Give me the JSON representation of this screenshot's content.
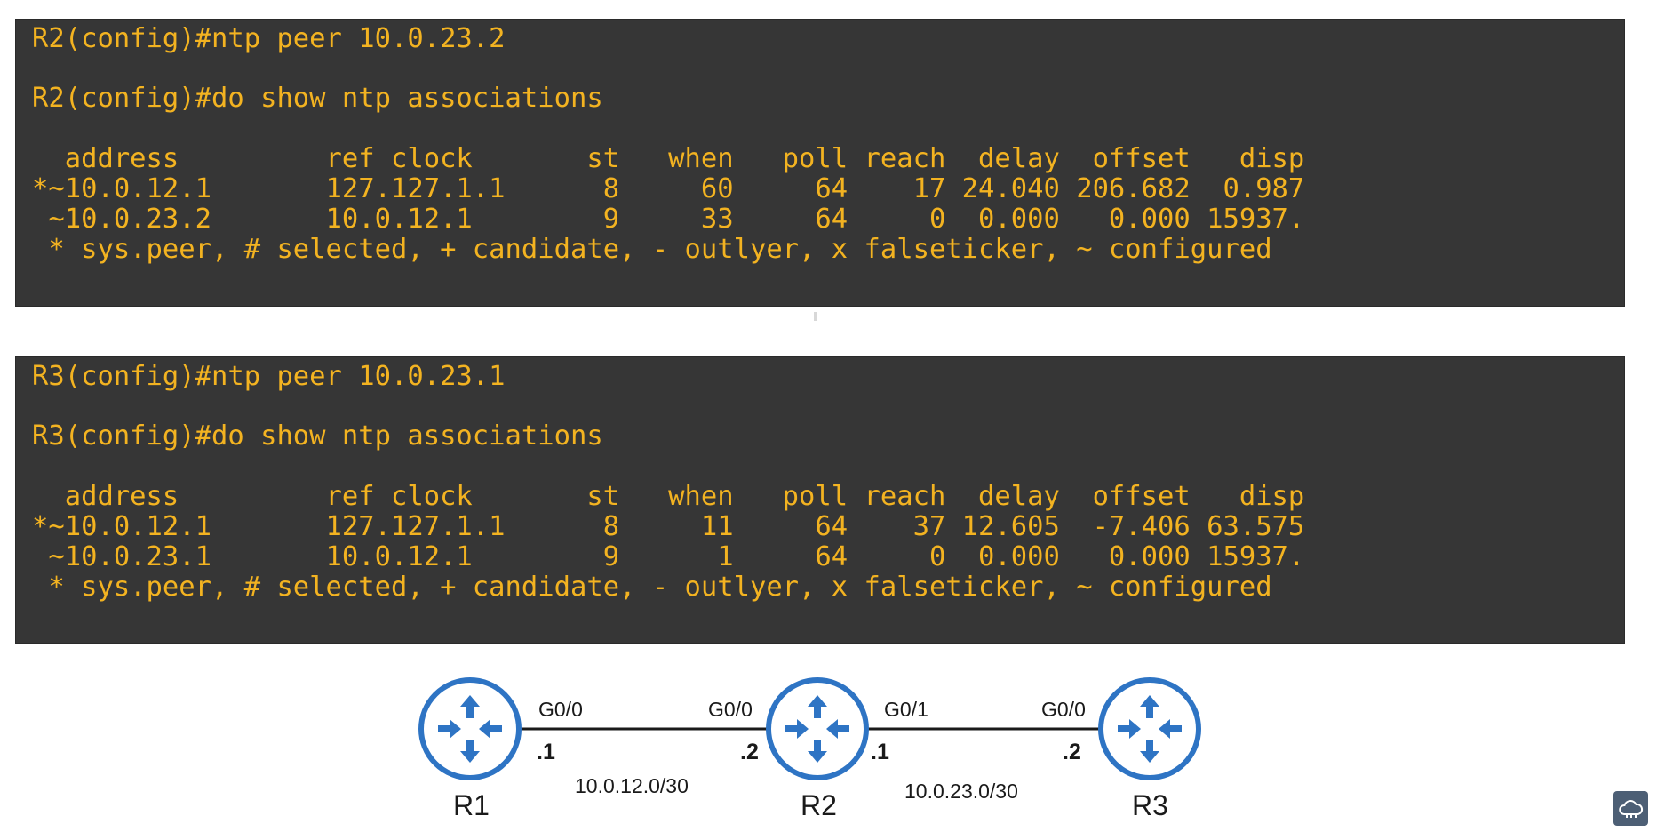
{
  "terminals": [
    {
      "lines": [
        "R2(config)#ntp peer 10.0.23.2",
        "",
        "R2(config)#do show ntp associations",
        "",
        "  address         ref clock       st   when   poll reach  delay  offset   disp",
        "*~10.0.12.1       127.127.1.1      8     60     64    17 24.040 206.682  0.987",
        " ~10.0.23.2       10.0.12.1        9     33     64     0  0.000   0.000 15937.",
        " * sys.peer, # selected, + candidate, - outlyer, x falseticker, ~ configured"
      ]
    },
    {
      "lines": [
        "R3(config)#ntp peer 10.0.23.1",
        "",
        "R3(config)#do show ntp associations",
        "",
        "  address         ref clock       st   when   poll reach  delay  offset   disp",
        "*~10.0.12.1       127.127.1.1      8     11     64    37 12.605  -7.406 63.575",
        " ~10.0.23.1       10.0.12.1        9      1     64     0  0.000   0.000 15937.",
        " * sys.peer, # selected, + candidate, - outlyer, x falseticker, ~ configured"
      ]
    }
  ],
  "diagram": {
    "routers": [
      {
        "name": "R1",
        "icon": "router-icon"
      },
      {
        "name": "R2",
        "icon": "router-icon"
      },
      {
        "name": "R3",
        "icon": "router-icon"
      }
    ],
    "links": [
      {
        "subnet": "10.0.12.0/30",
        "left_interface": "G0/0",
        "right_interface": "G0/0",
        "left_host": ".1",
        "right_host": ".2"
      },
      {
        "subnet": "10.0.23.0/30",
        "left_interface": "G0/1",
        "right_interface": "G0/0",
        "left_host": ".1",
        "right_host": ".2"
      }
    ],
    "colors": {
      "router": "#2e74c4",
      "link": "#1a1a1a"
    }
  },
  "terminal_colors": {
    "background": "#363636",
    "text": "#f3b321"
  },
  "corner_badge": {
    "icon": "cloud-network-icon"
  }
}
